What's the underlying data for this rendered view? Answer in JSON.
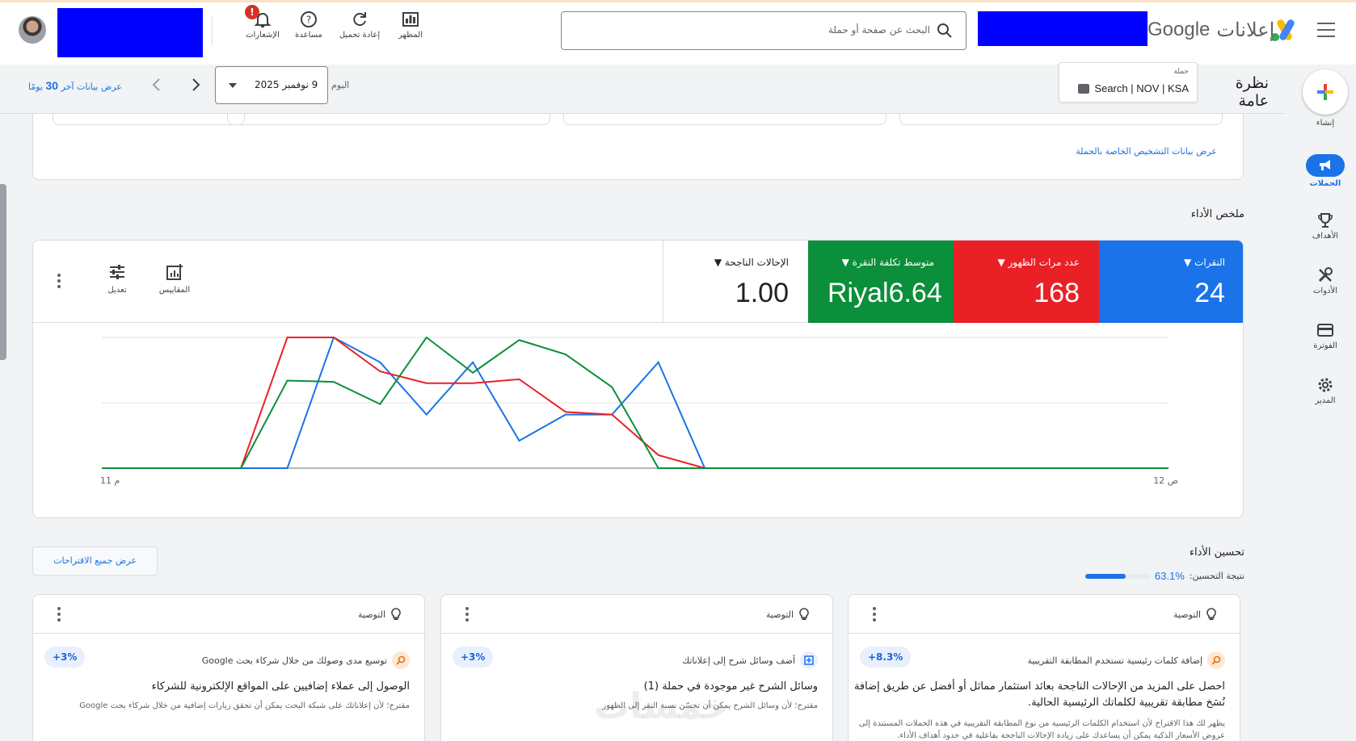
{
  "topbar": {
    "product_name": "إعلانات",
    "brand": "Google",
    "search_placeholder": "البحث عن صفحة أو حملة",
    "tools": [
      {
        "label": "المظهر",
        "icon": "appearance-icon"
      },
      {
        "label": "إعادة تحميل",
        "icon": "refresh-icon"
      },
      {
        "label": "مساعدة",
        "icon": "help-icon"
      },
      {
        "label": "الإشعارات",
        "icon": "bell-icon",
        "badge": "!"
      }
    ]
  },
  "rail": {
    "create_label": "إنشاء",
    "items": [
      {
        "label": "الحملات",
        "icon": "campaigns-icon",
        "active": true
      },
      {
        "label": "الأهداف",
        "icon": "trophy-icon"
      },
      {
        "label": "الأدوات",
        "icon": "tools-icon"
      },
      {
        "label": "الفوترة",
        "icon": "billing-icon"
      },
      {
        "label": "المدير",
        "icon": "gear-icon"
      }
    ]
  },
  "header": {
    "page_title": "نظرة عامة",
    "campaign_caption": "حملة",
    "campaign_name": "Search | NOV | KSA",
    "date_caption": "اليوم",
    "date_value": "9 نوفمبر 2025",
    "last30_prefix": "عرض بيانات آخر ",
    "last30_num": "30",
    "last30_suffix": " يومًا"
  },
  "diagnostics": {
    "link": "عرض بيانات التشخيص الخاصة بالحملة"
  },
  "performance": {
    "section_title": "ملخص الأداء",
    "metrics": [
      {
        "label": "النقرات",
        "value": "24",
        "color": "#1a73e8"
      },
      {
        "label": "عدد مرات الظهور",
        "value": "168",
        "color": "#ea2027"
      },
      {
        "label": "متوسط تكلفة النقرة",
        "value": "Riyal6.64",
        "color": "#0b8f3a"
      },
      {
        "label": "الإحالات الناجحة",
        "value": "1.00",
        "color": "#ffffff"
      }
    ],
    "actions": {
      "metrics_label": "المقاييس",
      "adjust_label": "تعديل"
    }
  },
  "chart_data": {
    "type": "line",
    "x_tick_labels": [
      "12 ص",
      "11 م"
    ],
    "x": [
      0,
      1,
      2,
      3,
      4,
      5,
      6,
      7,
      8,
      9,
      10,
      11,
      12,
      13,
      14,
      15,
      16,
      17,
      18,
      19,
      20,
      21,
      22,
      23
    ],
    "series": [
      {
        "color": "#1a73e8",
        "values": [
          0,
          0,
          0,
          0,
          0,
          0,
          0,
          0,
          0,
          0,
          0,
          0.81,
          0.41,
          0.41,
          0.21,
          0.81,
          0.41,
          0.81,
          1.0,
          0,
          0,
          0,
          0,
          0
        ]
      },
      {
        "color": "#ea2027",
        "values": [
          0,
          0,
          0,
          0,
          0,
          0,
          0,
          0,
          0,
          0,
          0,
          0.1,
          0.41,
          0.43,
          0.68,
          0.65,
          0.65,
          0.74,
          1.0,
          1.0,
          0,
          0,
          0,
          0
        ]
      },
      {
        "color": "#0b8f3a",
        "values": [
          0,
          0,
          0,
          0,
          0,
          0,
          0,
          0,
          0,
          0,
          0,
          0,
          0.62,
          0.87,
          0.98,
          0.73,
          1.0,
          0.49,
          0.66,
          0.67,
          0,
          0,
          0,
          0
        ]
      }
    ],
    "grid": true,
    "legend": "none"
  },
  "optimization": {
    "section_title": "تحسين الأداء",
    "score_label": "نتيجة التحسين:",
    "score_value": "63.1%",
    "score_fraction": 0.631,
    "view_all": "عرض جميع الاقتراحات"
  },
  "recommendations": [
    {
      "tag": "التوصية",
      "pill": "+8.3%",
      "subtitle": "إضافة كلمات رئيسية تستخدم المطابقة التقريبية",
      "sub_icon": "search-icon",
      "title": "احصل على المزيد من الإحالات الناجحة بعائد استثمار مماثل أو أفضل عن طريق إضافة نُسَخ مطابقة تقريبية لكلماتك الرئيسية الحالية.",
      "note": "يظهر لك هذا الاقتراح لأن استخدام الكلمات الرئيسية من نوع المطابقة التقريبية في هذه الحملات المستندة إلى عروض الأسعار الذكية يمكن أن يساعدك على زيادة الإحالات الناجحة بفاعلية في حدود أهداف الأداء."
    },
    {
      "tag": "التوصية",
      "pill": "+3%",
      "subtitle": "أضف وسائل شرح إلى إعلاناتك",
      "sub_icon": "callout-icon",
      "title": "وسائل الشرح غير موجودة في حملة (1)",
      "note": "مقترح؛ لأن وسائل الشرح يمكن أن تحسّن نسبة النقر إلى الظهور"
    },
    {
      "tag": "التوصية",
      "pill": "+3%",
      "subtitle": "توسيع مدى وصولك من خلال شركاء بحث Google",
      "sub_icon": "search-icon",
      "title": "الوصول إلى عملاء إضافيين على المواقع الإلكترونية للشركاء",
      "note": "مقترح؛ لأن إعلاناتك على شبكة البحث يمكن أن تحقق زيارات إضافية من خلال شركاء بحث Google"
    }
  ],
  "watermark": "خمسات"
}
